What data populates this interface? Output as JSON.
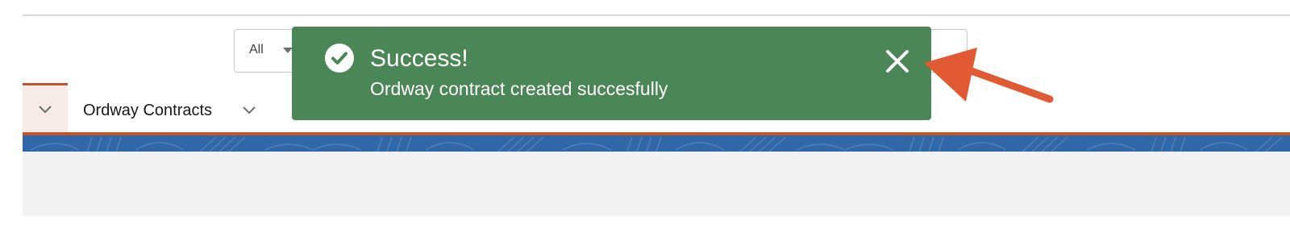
{
  "search": {
    "scope_label": "All"
  },
  "nav": {
    "items": [
      {
        "label": "Ordway Contracts"
      }
    ]
  },
  "toast": {
    "title": "Success!",
    "message": "Ordway contract created succesfully",
    "icon": "check-circle-icon",
    "close_icon": "close-icon",
    "background": "#4b8656"
  },
  "annotation": {
    "icon": "arrow-icon",
    "color": "#e25a34"
  },
  "colors": {
    "accent": "#c2542a",
    "banner": "#2f67a8"
  }
}
